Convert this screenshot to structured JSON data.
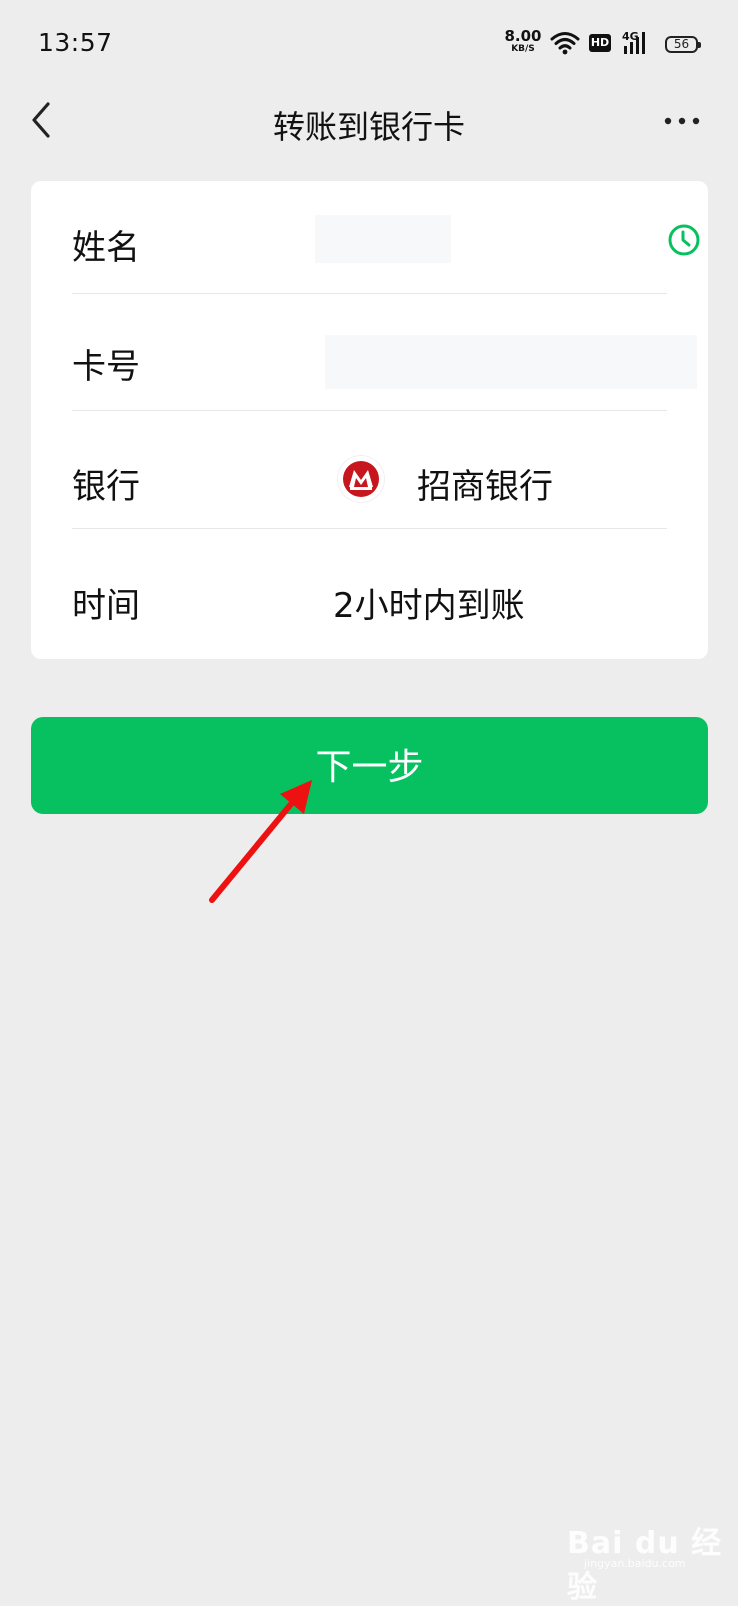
{
  "status_bar": {
    "time": "13:57",
    "net_speed_value": "8.00",
    "net_speed_unit": "KB/S",
    "hd_badge": "HD",
    "network_type": "4G",
    "battery": "56"
  },
  "header": {
    "title": "转账到银行卡"
  },
  "form": {
    "name_label": "姓名",
    "name_value": "",
    "card_label": "卡号",
    "card_value": "",
    "bank_label": "银行",
    "bank_name": "招商银行",
    "time_label": "时间",
    "time_value": "2小时内到账"
  },
  "button": {
    "next_label": "下一步"
  },
  "icons": {
    "back": "chevron-left-icon",
    "more": "more-icon",
    "history": "clock-icon",
    "bank_logo": "cmb-logo"
  },
  "colors": {
    "accent": "#07c160",
    "annotation_arrow": "#ee1111",
    "bank_logo_red": "#c8161e"
  },
  "watermark": {
    "text": "Bai du 经验",
    "sub": "jingyan.baidu.com"
  }
}
